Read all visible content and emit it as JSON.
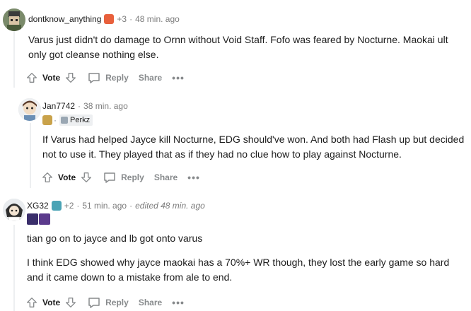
{
  "comments": [
    {
      "username": "dontknow_anything",
      "score": "+3",
      "time": "48 min. ago",
      "body": [
        "Varus just didn't do damage to Ornn without Void Staff. Fofo was feared by Nocturne. Maokai ult only got cleanse nothing else."
      ],
      "actions": {
        "vote": "Vote",
        "reply": "Reply",
        "share": "Share",
        "more": "•••"
      }
    },
    {
      "username": "Jan7742",
      "time": "38 min. ago",
      "flair_text": "Perkz",
      "body": [
        "If Varus had helped Jayce kill Nocturne, EDG should've won. And both had Flash up but decided not to use it. They played that as if they had no clue how to play against Nocturne."
      ],
      "actions": {
        "vote": "Vote",
        "reply": "Reply",
        "share": "Share",
        "more": "•••"
      }
    },
    {
      "username": "XG32",
      "score": "+2",
      "time": "51 min. ago",
      "edited": "edited 48 min. ago",
      "body": [
        "tian go on to jayce and lb got onto varus",
        "I think EDG showed why jayce maokai has a 70%+ WR though, they lost the early game so hard and it came down to a mistake from ale to end."
      ],
      "actions": {
        "vote": "Vote",
        "reply": "Reply",
        "share": "Share",
        "more": "•••"
      }
    }
  ],
  "separator": "·",
  "colors": {
    "thread_line": "#edeff1",
    "meta": "#7c7c7c",
    "action": "#878a8c",
    "text": "#1c1c1c"
  }
}
